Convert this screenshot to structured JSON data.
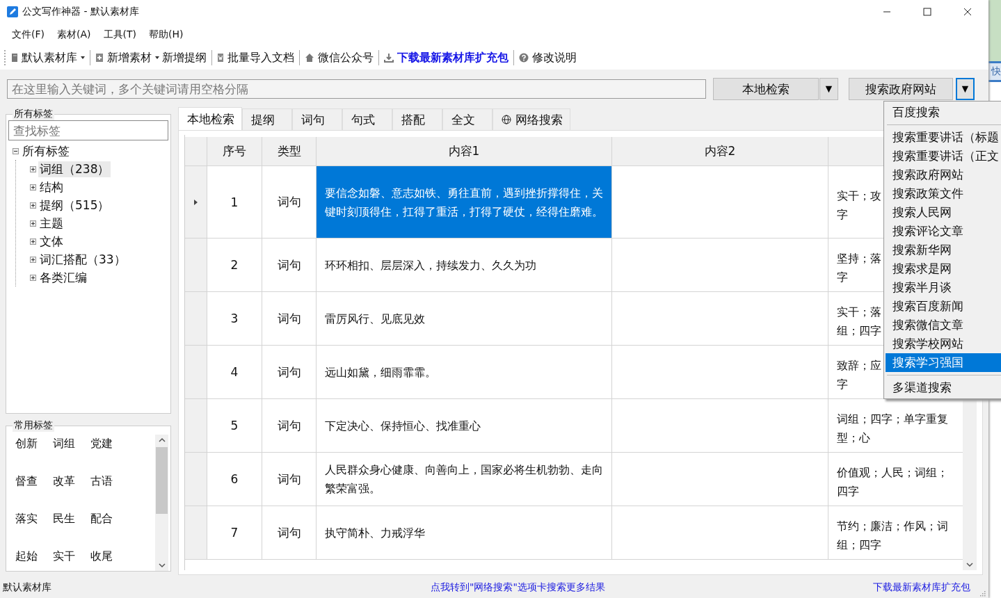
{
  "window": {
    "title": "公文写作神器 - 默认素材库"
  },
  "menu_bar": [
    "文件(F)",
    "素材(A)",
    "工具(T)",
    "帮助(H)"
  ],
  "toolbar": [
    {
      "label": "默认素材库",
      "kind": "dropdown"
    },
    {
      "label": "新增素材",
      "kind": "dropdown"
    },
    {
      "label": "新增提纲",
      "kind": "button"
    },
    {
      "label": "批量导入文档",
      "kind": "button"
    },
    {
      "label": "微信公众号",
      "kind": "button"
    },
    {
      "label": "下载最新素材库扩充包",
      "kind": "link"
    },
    {
      "label": "修改说明",
      "kind": "button"
    }
  ],
  "search": {
    "placeholder": "在这里输入关键词，多个关键词请用空格分隔",
    "local_button": "本地检索",
    "web_button": "搜索政府网站",
    "web_dropdown_open": true,
    "arrow": "▼"
  },
  "all_tags": {
    "title": "所有标签",
    "placeholder": "查找标签",
    "tree": [
      {
        "label": "所有标签",
        "expanded": true,
        "selected": false,
        "children": [
          {
            "label": "词组（238）",
            "expanded": false,
            "selected": true
          },
          {
            "label": "结构",
            "expanded": false,
            "selected": false
          },
          {
            "label": "提纲（515）",
            "expanded": false,
            "selected": false
          },
          {
            "label": "主题",
            "expanded": false,
            "selected": false
          },
          {
            "label": "文体",
            "expanded": false,
            "selected": false
          },
          {
            "label": "词汇搭配（33）",
            "expanded": false,
            "selected": false
          },
          {
            "label": "各类汇编",
            "expanded": false,
            "selected": false
          }
        ]
      }
    ]
  },
  "common_tags": {
    "title": "常用标签",
    "tags": [
      "创新",
      "词组",
      "党建",
      "督查",
      "改革",
      "古语",
      "落实",
      "民生",
      "配合",
      "起始",
      "实干",
      "收尾"
    ]
  },
  "tabs": [
    {
      "label": "本地检索",
      "selected": true
    },
    {
      "label": "提纲",
      "selected": false
    },
    {
      "label": "词句",
      "selected": false
    },
    {
      "label": "句式",
      "selected": false
    },
    {
      "label": "搭配",
      "selected": false
    },
    {
      "label": "全文",
      "selected": false
    },
    {
      "label": "网络搜索",
      "selected": false
    }
  ],
  "table": {
    "columns": [
      "序号",
      "类型",
      "内容1",
      "内容2"
    ],
    "rows": [
      {
        "selected": true,
        "number": "1",
        "type": "词句",
        "content1": "要信念如磐、意志如铁、勇往直前，遇到挫折撑得住，关键时刻顶得住，扛得了重活，打得了硬仗，经得住磨难。",
        "column_3": [
          "实干；攻",
          "字"
        ]
      },
      {
        "selected": false,
        "number": "2",
        "type": "词句",
        "content1": "环环相扣、层层深入，持续发力、久久为功",
        "column_3": [
          "坚持；落",
          "字"
        ]
      },
      {
        "selected": false,
        "number": "3",
        "type": "词句",
        "content1": "雷厉风行、见底见效",
        "column_3": [
          "实干；落",
          "组；四字"
        ]
      },
      {
        "selected": false,
        "number": "4",
        "type": "词句",
        "content1": "远山如黛，细雨霏霏。",
        "column_3": [
          "致辞；应",
          "字"
        ]
      },
      {
        "selected": false,
        "number": "5",
        "type": "词句",
        "content1": "下定决心、保持恒心、找准重心",
        "column_3": [
          "词组；四字；单字重复",
          "型；心"
        ]
      },
      {
        "selected": false,
        "number": "6",
        "type": "词句",
        "content1": "人民群众身心健康、向善向上，国家必将生机勃勃、走向繁荣富强。",
        "column_3": [
          "价值观；人民；词组；",
          "四字"
        ]
      },
      {
        "selected": false,
        "number": "7",
        "type": "词句",
        "content1": "执守简朴、力戒浮华",
        "column_3": [
          "节约；廉洁；作风；词",
          "组；四字"
        ]
      }
    ]
  },
  "web_search_menu": [
    {
      "label": "百度搜索",
      "selected": false,
      "separator_after": true
    },
    {
      "label": "搜索重要讲话（标题",
      "selected": false,
      "separator_after": false
    },
    {
      "label": "搜索重要讲话（正文",
      "selected": false,
      "separator_after": false
    },
    {
      "label": "搜索政府网站",
      "selected": false,
      "separator_after": false
    },
    {
      "label": "搜索政策文件",
      "selected": false,
      "separator_after": false
    },
    {
      "label": "搜索人民网",
      "selected": false,
      "separator_after": false
    },
    {
      "label": "搜索评论文章",
      "selected": false,
      "separator_after": false
    },
    {
      "label": "搜索新华网",
      "selected": false,
      "separator_after": false
    },
    {
      "label": "搜索求是网",
      "selected": false,
      "separator_after": false
    },
    {
      "label": "搜索半月谈",
      "selected": false,
      "separator_after": false
    },
    {
      "label": "搜索百度新闻",
      "selected": false,
      "separator_after": false
    },
    {
      "label": "搜索微信文章",
      "selected": false,
      "separator_after": false
    },
    {
      "label": "搜索学校网站",
      "selected": false,
      "separator_after": false
    },
    {
      "label": "搜索学习强国",
      "selected": true,
      "separator_after": true
    },
    {
      "label": "多渠道搜索",
      "selected": false,
      "separator_after": false
    }
  ],
  "status_bar": {
    "library": "默认素材库",
    "hint_link": "点我转到\"网络搜索\"选项卡搜索更多结果",
    "download_link": "下载最新素材库扩充包"
  },
  "background_window": {
    "text": "快"
  }
}
